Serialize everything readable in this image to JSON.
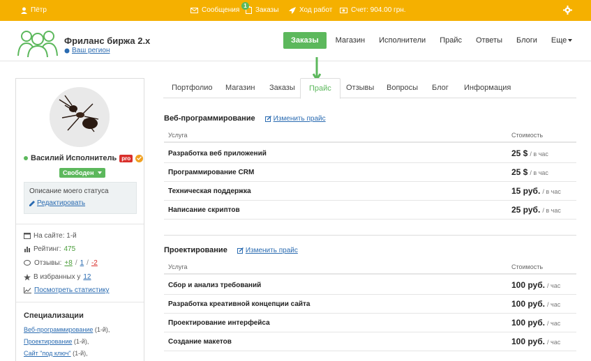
{
  "topbar": {
    "user": "Пётр",
    "messages": "Сообщения",
    "orders": "Заказы",
    "orders_badge": "1",
    "progress": "Ход работ",
    "account": "Счет: 904.00 грн."
  },
  "header": {
    "title": "Фриланс биржа 2.х",
    "region": "Ваш регион",
    "nav": [
      "Заказы",
      "Магазин",
      "Исполнители",
      "Прайс",
      "Ответы",
      "Блоги",
      "Еще"
    ]
  },
  "sidebar": {
    "name": "Василий Исполнитель",
    "pro": "pro",
    "status": "Свободен",
    "status_desc": "Описание моего статуса",
    "edit": "Редактировать",
    "on_site": "На сайте: 1-й",
    "rating_label": "Рейтинг:",
    "rating_value": "475",
    "reviews_label": "Отзывы:",
    "reviews_pos": "+8",
    "reviews_neu": "1",
    "reviews_neg": "-2",
    "favorites_label": "В избранных у",
    "favorites_value": "12",
    "stats_link": "Посмотреть статистику",
    "spec_title": "Специализации",
    "specs": [
      {
        "name": "Веб-программирование",
        "rank": "(1-й),"
      },
      {
        "name": "Проектирование",
        "rank": "(1-й),"
      },
      {
        "name": "Сайт \"под ключ\"",
        "rank": "(1-й),"
      }
    ]
  },
  "tabs": [
    "Портфолио",
    "Магазин",
    "Заказы",
    "Прайс",
    "Отзывы",
    "Вопросы",
    "Блог",
    "Информация"
  ],
  "sections": [
    {
      "title": "Веб-программирование",
      "change": "Изменить прайс",
      "col_service": "Услуга",
      "col_price": "Стоимость",
      "rows": [
        {
          "service": "Разработка веб приложений",
          "amount": "25 $",
          "per": "/ в час"
        },
        {
          "service": "Программирование CRM",
          "amount": "25 $",
          "per": "/ в час"
        },
        {
          "service": "Техническая поддержка",
          "amount": "15 руб.",
          "per": "/ в час"
        },
        {
          "service": "Написание скриптов",
          "amount": "25 руб.",
          "per": "/ в час"
        }
      ]
    },
    {
      "title": "Проектирование",
      "change": "Изменить прайс",
      "col_service": "Услуга",
      "col_price": "Стоимость",
      "rows": [
        {
          "service": "Сбор и анализ требований",
          "amount": "100 руб.",
          "per": "/ час"
        },
        {
          "service": "Разработка креативной концепции сайта",
          "amount": "100 руб.",
          "per": "/ час"
        },
        {
          "service": "Проектирование интерфейса",
          "amount": "100 руб.",
          "per": "/ час"
        },
        {
          "service": "Создание макетов",
          "amount": "100 руб.",
          "per": "/ час"
        }
      ]
    }
  ],
  "colors": {
    "topbar": "#f5b000",
    "accent_green": "#5cb85c",
    "link": "#2a6bb1",
    "pro_red": "#d9302c"
  }
}
